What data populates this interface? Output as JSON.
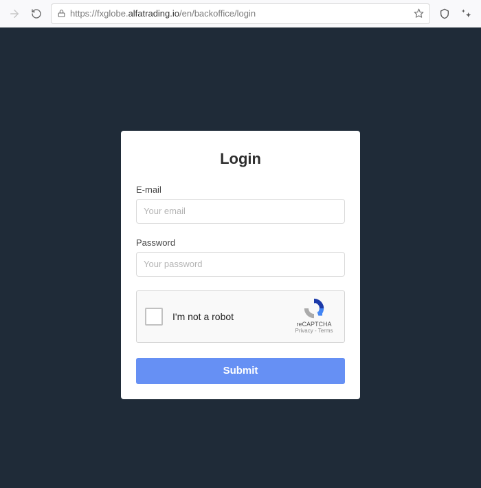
{
  "browser": {
    "url_pre": "https://fxglobe.",
    "url_strong": "alfatrading.io",
    "url_post": "/en/backoffice/login"
  },
  "login": {
    "title": "Login",
    "email_label": "E-mail",
    "email_placeholder": "Your email",
    "password_label": "Password",
    "password_placeholder": "Your password",
    "submit_label": "Submit"
  },
  "recaptcha": {
    "label": "I'm not a robot",
    "brand": "reCAPTCHA",
    "privacy": "Privacy",
    "terms": "Terms",
    "sep": " - "
  }
}
